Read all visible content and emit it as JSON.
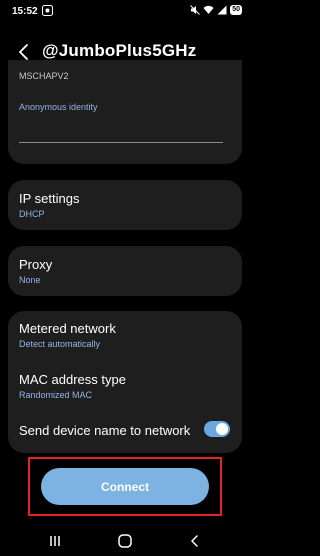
{
  "status_bar": {
    "time": "15:52",
    "battery": "50",
    "icons": [
      "notification-icon",
      "mute-icon",
      "wifi-icon",
      "signal-icon",
      "battery-icon"
    ]
  },
  "header": {
    "title": "@JumboPlus5GHz",
    "back_icon": "chevron-left-icon"
  },
  "eap_section": {
    "phase2_value": "MSCHAPV2",
    "anonymous_identity_label": "Anonymous identity",
    "anonymous_identity_value": ""
  },
  "ip_settings": {
    "label": "IP settings",
    "value": "DHCP"
  },
  "proxy": {
    "label": "Proxy",
    "value": "None"
  },
  "metered_network": {
    "label": "Metered network",
    "value": "Detect automatically"
  },
  "mac_address": {
    "label": "MAC address type",
    "value": "Randomized MAC"
  },
  "send_device_name": {
    "label": "Send device name to network",
    "enabled": true
  },
  "connect_button": {
    "label": "Connect"
  },
  "nav_bar": {
    "icons": [
      "recents-icon",
      "home-icon",
      "back-icon"
    ]
  },
  "colors": {
    "background": "#000000",
    "card": "#1e1e1e",
    "accent": "#8fb6e6",
    "button": "#7db3e2",
    "highlight": "#e22424"
  }
}
